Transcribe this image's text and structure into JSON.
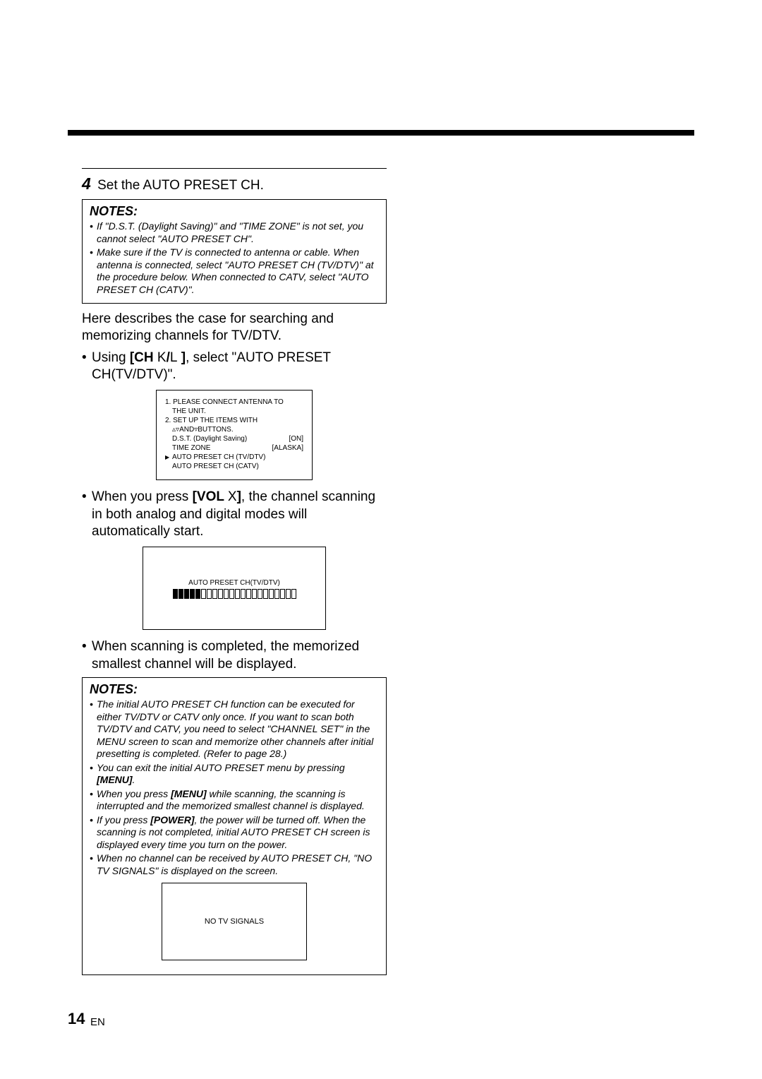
{
  "step": {
    "num": "4",
    "text": "Set the AUTO PRESET CH."
  },
  "notes1": {
    "title": "NOTES:",
    "items": [
      "If \"D.S.T. (Daylight Saving)\" and \"TIME ZONE\" is not set, you cannot select \"AUTO PRESET CH\".",
      "Make sure if the TV is connected to antenna or cable. When antenna is connected, select \"AUTO PRESET CH (TV/DTV)\" at the procedure below.  When connected to CATV, select \"AUTO PRESET CH (CATV)\"."
    ]
  },
  "para1": "Here describes the case for searching and memorizing channels for TV/DTV.",
  "bullet1a": "Using ",
  "bullet1b": "[CH ",
  "bullet1c": "K",
  "bullet1d": "/",
  "bullet1e": "L",
  "bullet1f": " ]",
  "bullet1g": ", select \"AUTO PRESET CH(TV/DTV)\".",
  "osd1": {
    "l1": "1. PLEASE CONNECT ANTENNA TO",
    "l2": "THE UNIT.",
    "l3": "2. SET UP THE ITEMS WITH",
    "l4pre": "▵▿",
    "l4a": "AND",
    "l4b": "▿",
    "l4c": "BUTTONS.",
    "dst_label": "D.S.T. (Daylight Saving)",
    "dst_val": "[ON]",
    "tz_label": "TIME ZONE",
    "tz_val": "[ALASKA]",
    "ap1": "AUTO PRESET CH (TV/DTV)",
    "ap2": "AUTO PRESET CH (CATV)"
  },
  "bullet2a": "When you press ",
  "bullet2b": "[VOL ",
  "bullet2c": "X",
  "bullet2d": "]",
  "bullet2e": ", the channel scanning in both analog and digital modes will automatically start.",
  "osd2": {
    "title": "AUTO PRESET CH(TV/DTV)",
    "filled": 5,
    "total": 22
  },
  "bullet3": "When scanning is completed, the memorized smallest channel will be displayed.",
  "notes2": {
    "title": "NOTES:",
    "items": [
      "The initial AUTO PRESET CH function can be executed for either TV/DTV or CATV only once. If you want to scan both TV/DTV and CATV, you need to select \"CHANNEL SET\" in the MENU screen to scan and memorize other channels after initial presetting is completed. (Refer to page 28.)",
      {
        "pre": "You can exit the initial AUTO PRESET menu by pressing ",
        "strong": "[MENU]",
        "post": "."
      },
      {
        "pre": "When you press ",
        "strong": "[MENU]",
        "post": " while scanning, the scanning is interrupted and the memorized smallest channel is displayed."
      },
      {
        "pre": "If you press ",
        "strong": "[POWER]",
        "post": ", the power will be turned off. When the scanning is not completed, initial AUTO PRESET CH screen is displayed every time you turn on the power."
      },
      "When no channel can be received by AUTO PRESET CH, \"NO TV SIGNALS\" is displayed on the screen."
    ]
  },
  "osd3": {
    "text": "NO TV SIGNALS"
  },
  "page_number": "14",
  "page_lang": "EN"
}
